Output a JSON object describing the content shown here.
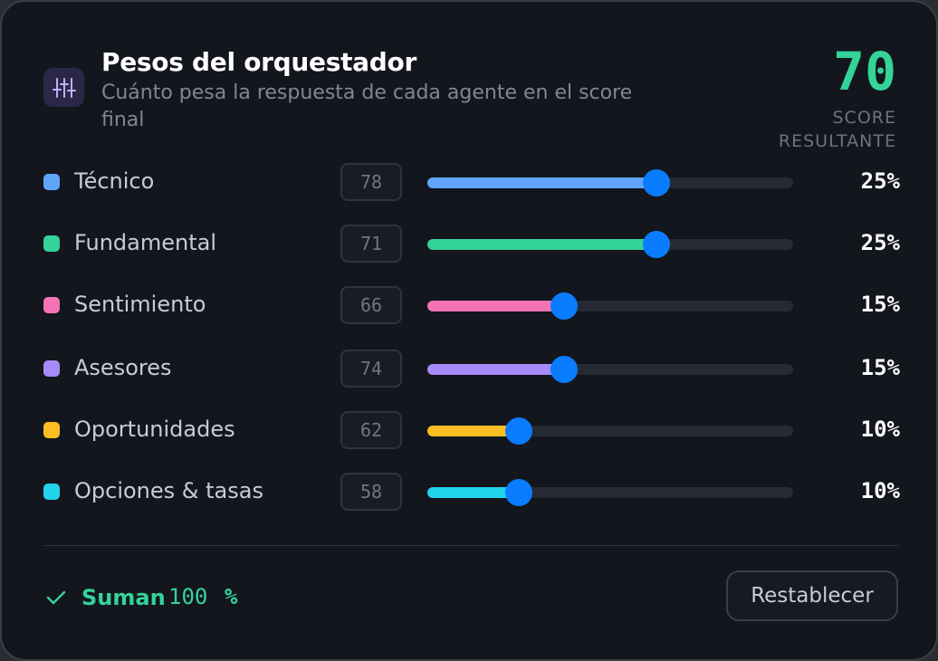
{
  "header": {
    "icon": "sliders-icon",
    "title": "Pesos del orquestador",
    "subtitle": "Cuánto pesa la respuesta de cada agente en el score final"
  },
  "score": {
    "value": "70",
    "label": "SCORE RESULTANTE",
    "color": "#34d399"
  },
  "agents": [
    {
      "label": "Técnico",
      "score": "78",
      "weight_label": "25%",
      "weight": 0.25,
      "color": "#60a5fa"
    },
    {
      "label": "Fundamental",
      "score": "71",
      "weight_label": "25%",
      "weight": 0.25,
      "color": "#34d399"
    },
    {
      "label": "Sentimiento",
      "score": "66",
      "weight_label": "15%",
      "weight": 0.15,
      "color": "#f472b6"
    },
    {
      "label": "Asesores",
      "score": "74",
      "weight_label": "15%",
      "weight": 0.15,
      "color": "#a78bfa"
    },
    {
      "label": "Oportunidades",
      "score": "62",
      "weight_label": "10%",
      "weight": 0.1,
      "color": "#fbbf24"
    },
    {
      "label": "Opciones & tasas",
      "score": "58",
      "weight_label": "10%",
      "weight": 0.1,
      "color": "#22d3ee"
    }
  ],
  "slider": {
    "max_weight": 0.4,
    "thumb_color": "#0a7cff"
  },
  "footer": {
    "check_icon": "check-icon",
    "sum_text": "Suman",
    "sum_value": "100",
    "sum_unit": "%",
    "reset_label": "Restablecer"
  }
}
